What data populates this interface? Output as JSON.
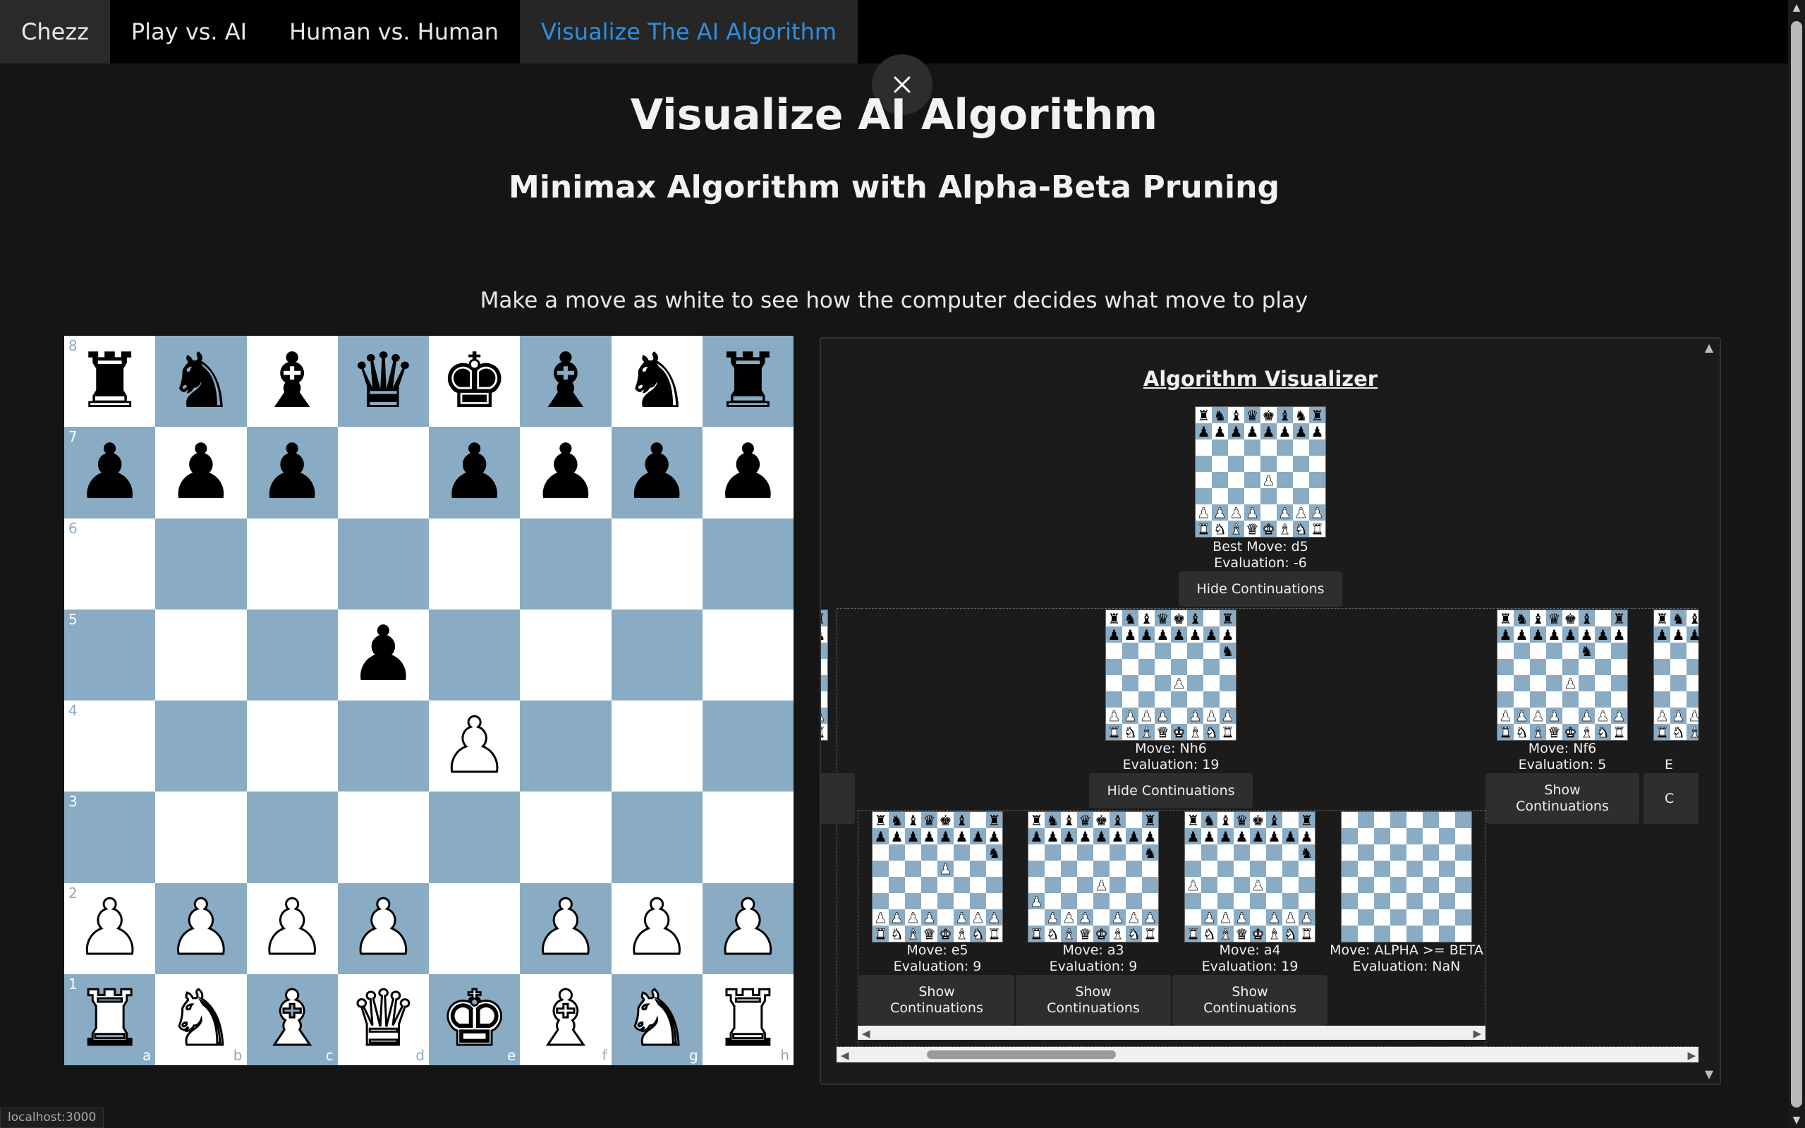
{
  "nav": {
    "brand": "Chezz",
    "items": [
      "Play vs. AI",
      "Human vs. Human",
      "Visualize The AI Algorithm"
    ]
  },
  "page": {
    "title": "Visualize AI Algorithm",
    "subtitle": "Minimax Algorithm with Alpha-Beta Pruning",
    "instruction": "Make a move as white to see how the computer decides what move to play"
  },
  "board": {
    "ranks": [
      "8",
      "7",
      "6",
      "5",
      "4",
      "3",
      "2",
      "1"
    ],
    "files": [
      "a",
      "b",
      "c",
      "d",
      "e",
      "f",
      "g",
      "h"
    ],
    "position": [
      "rnbqkbnr",
      "ppp.pppp",
      "........",
      "...p....",
      "....P...",
      "........",
      "PPPP.PPP",
      "RNBQKBNR"
    ],
    "colors": {
      "light": "#ffffff",
      "dark": "#8aabc4"
    }
  },
  "visualizer": {
    "heading": "Algorithm Visualizer",
    "root": {
      "best_move": "Best Move: d5",
      "evaluation": "Evaluation: -6",
      "button": "Hide Continuations"
    },
    "level1": [
      {
        "move": "Move: Nh6",
        "evaluation": "Evaluation: 19",
        "button": "Hide Continuations"
      },
      {
        "move": "Move: Nf6",
        "evaluation": "Evaluation: 5",
        "button": "Show Continuations"
      },
      {
        "move": "E",
        "button": "C"
      }
    ],
    "level2": [
      {
        "move": "Move: e5",
        "evaluation": "Evaluation: 9",
        "button": "Show Continuations"
      },
      {
        "move": "Move: a3",
        "evaluation": "Evaluation: 9",
        "button": "Show Continuations"
      },
      {
        "move": "Move: a4",
        "evaluation": "Evaluation: 19",
        "button": "Show Continuations"
      },
      {
        "move": "Move: ALPHA >= BETA",
        "evaluation": "Evaluation: NaN"
      }
    ]
  },
  "status_url": "localhost:3000",
  "icons": {
    "close": "close-icon"
  }
}
